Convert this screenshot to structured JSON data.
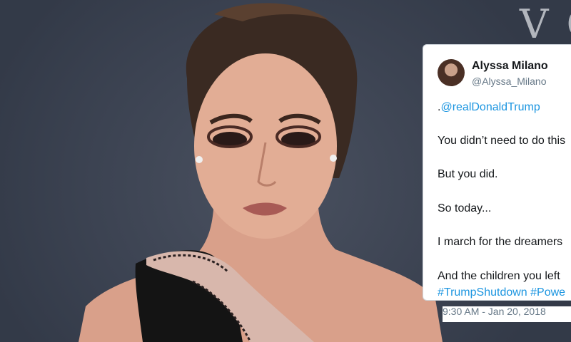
{
  "backdrop": {
    "text": "VO"
  },
  "tweet": {
    "name": "Alyssa Milano",
    "handle": "@Alyssa_Milano",
    "mention_prefix": ".",
    "mention": "@realDonaldTrump",
    "lines": [
      "You didn’t need to do this",
      "But you did.",
      "So today...",
      "I march for the dreamers",
      "And the children you left"
    ],
    "hashtags": "#TrumpShutdown #Powe",
    "timestamp": "9:30 AM - Jan 20, 2018"
  },
  "colors": {
    "backdrop": "#3f4655",
    "link": "#1b95e0",
    "verified": "#1da1f2",
    "text": "#14171a",
    "muted": "#657786"
  },
  "icons": {
    "verified": "verified-badge-icon"
  }
}
